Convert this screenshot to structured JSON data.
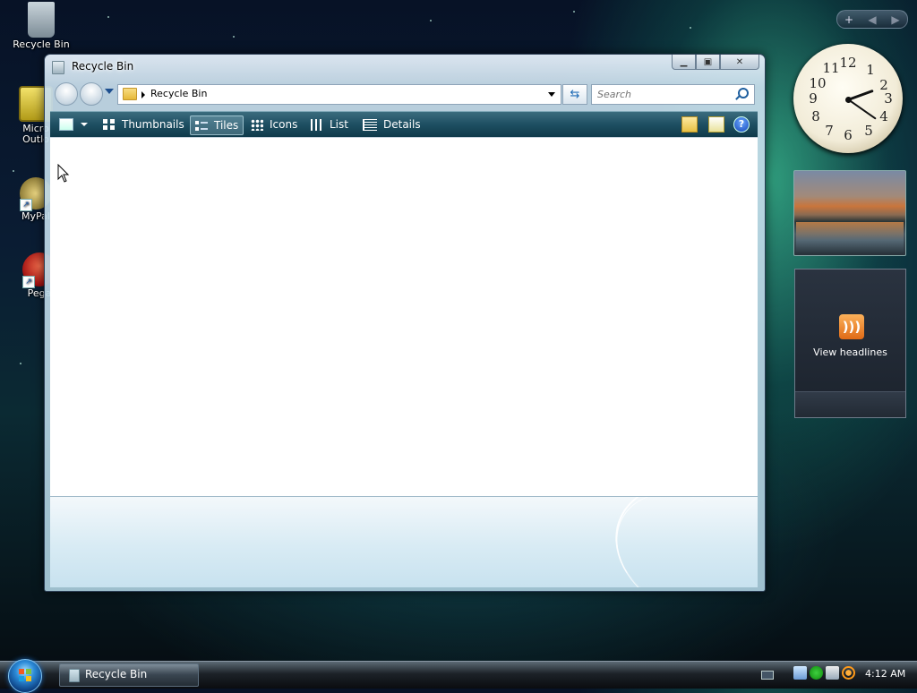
{
  "desktop": {
    "icons": [
      {
        "label": "Recycle Bin"
      },
      {
        "label": "Microsoft Outlook",
        "label_line1": "Micro",
        "label_line2": "Outlo"
      },
      {
        "label": "MyPal"
      },
      {
        "label": "Pega"
      }
    ]
  },
  "window": {
    "title": "Recycle Bin",
    "breadcrumb": "Recycle Bin",
    "search_placeholder": "Search",
    "toolbar": {
      "items": [
        {
          "label": "Thumbnails"
        },
        {
          "label": "Tiles"
        },
        {
          "label": "Icons"
        },
        {
          "label": "List"
        },
        {
          "label": "Details"
        }
      ],
      "help": "?"
    }
  },
  "gadgets": {
    "sidebar_controls": [
      "+",
      "◀",
      "▶"
    ],
    "clock": {
      "numbers": [
        "12",
        "1",
        "2",
        "3",
        "4",
        "5",
        "6",
        "7",
        "8",
        "9",
        "10",
        "11"
      ],
      "time": "4:12"
    },
    "feed": {
      "label": "View headlines"
    }
  },
  "taskbar": {
    "task_button": "Recycle Bin",
    "time": "4:12 AM"
  }
}
